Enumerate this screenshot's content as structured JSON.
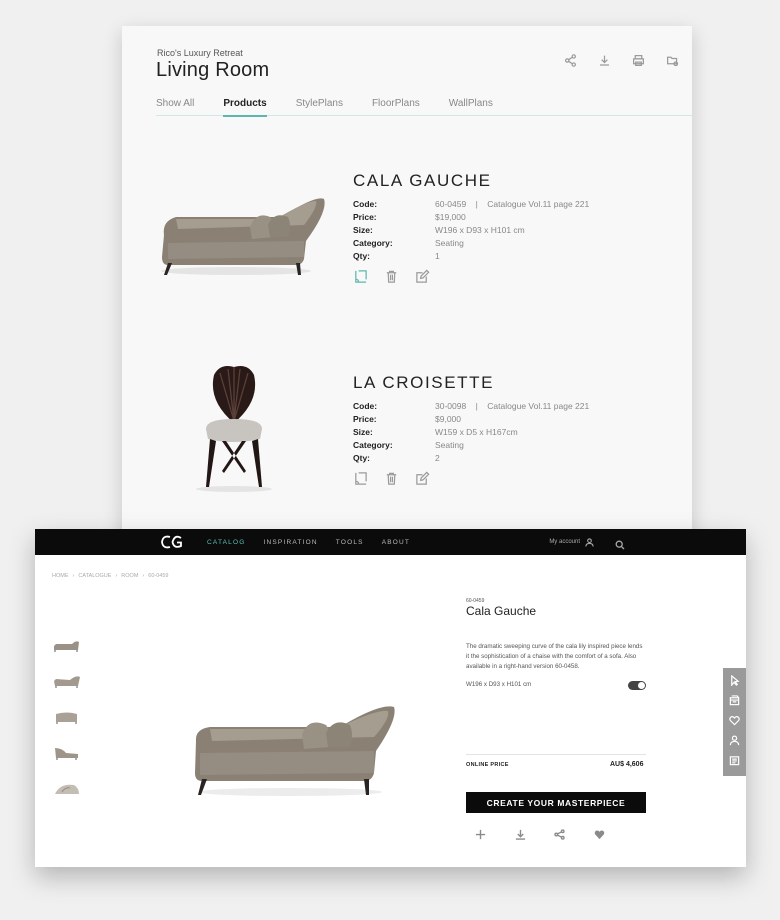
{
  "back_panel": {
    "subtitle": "Rico's Luxury Retreat",
    "title": "Living Room",
    "action_icons": [
      "share-icon",
      "download-icon",
      "print-icon",
      "folder-settings-icon"
    ],
    "tabs": [
      {
        "label": "Show All",
        "active": false
      },
      {
        "label": "Products",
        "active": true
      },
      {
        "label": "StylePlans",
        "active": false
      },
      {
        "label": "FloorPlans",
        "active": false
      },
      {
        "label": "WallPlans",
        "active": false
      }
    ],
    "products": [
      {
        "name": "CALA GAUCHE",
        "code_label": "Code:",
        "code": "60-0459    |    Catalogue Vol.11 page 221",
        "price_label": "Price:",
        "price": "$19,000",
        "size_label": "Size:",
        "size": "W196 x D93 x H101 cm",
        "category_label": "Category:",
        "category": "Seating",
        "qty_label": "Qty:",
        "qty": "1"
      },
      {
        "name": "LA CROISETTE",
        "code_label": "Code:",
        "code": "30-0098    |    Catalogue Vol.11 page 221",
        "price_label": "Price:",
        "price": "$9,000",
        "size_label": "Size:",
        "size": "W159 x D5 x H167cm",
        "category_label": "Category:",
        "category": "Seating",
        "qty_label": "Qty:",
        "qty": "2"
      }
    ]
  },
  "front_panel": {
    "logo_text": "CG",
    "nav": [
      "CATALOG",
      "INSPIRATION",
      "TOOLS",
      "ABOUT"
    ],
    "account_label": "My account",
    "breadcrumb": [
      "HOME",
      "›",
      "CATALOGUE",
      "›",
      "ROOM",
      "›",
      "60-0459"
    ],
    "product": {
      "code": "60-0459",
      "title": "Cala Gauche",
      "description": "The dramatic sweeping curve of the cala lily inspired piece lends it the sophistication of a chaise with the comfort of a sofa. Also available in a right-hand version 60-0458.",
      "dimensions": "W196 x D93 x H101 cm",
      "price_label": "ONLINE PRICE",
      "price": "AU$ 4,606",
      "cta_label": "CREATE YOUR MASTERPIECE"
    },
    "colors": {
      "accent": "#5bc2b4",
      "nav_bg": "#0b0b0b",
      "rail_bg": "#9a9a9a"
    }
  }
}
